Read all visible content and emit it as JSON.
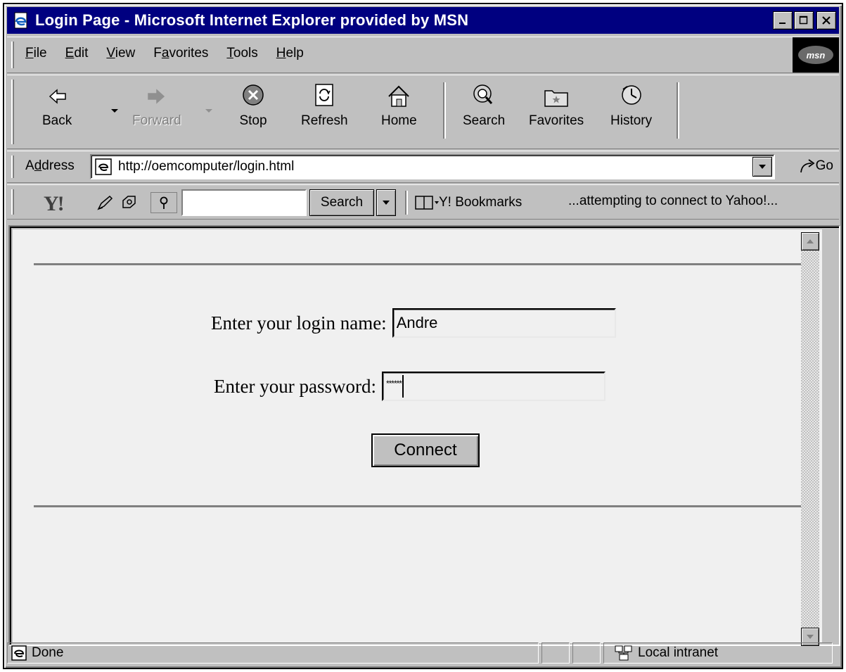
{
  "window": {
    "title": "Login Page - Microsoft Internet Explorer provided by MSN"
  },
  "menu": {
    "items": [
      {
        "label": "File",
        "accel": "F",
        "rest": "ile"
      },
      {
        "label": "Edit",
        "accel": "E",
        "rest": "dit"
      },
      {
        "label": "View",
        "accel": "V",
        "rest": "iew"
      },
      {
        "label": "Favorites",
        "pre": "F",
        "accel": "a",
        "rest": "vorites"
      },
      {
        "label": "Tools",
        "accel": "T",
        "rest": "ools"
      },
      {
        "label": "Help",
        "accel": "H",
        "rest": "elp"
      }
    ],
    "logo_text": "msn"
  },
  "toolbar": {
    "back": "Back",
    "forward": "Forward",
    "stop": "Stop",
    "refresh": "Refresh",
    "home": "Home",
    "search": "Search",
    "favorites": "Favorites",
    "history": "History"
  },
  "address": {
    "label_accel": "d",
    "label_pre": "A",
    "label_rest": "dress",
    "url": "http://oemcomputer/login.html",
    "go_label": "Go"
  },
  "yahoo": {
    "logo": "Y!",
    "search_value": "",
    "search_button": "Search",
    "bookmarks_label": "Y! Bookmarks",
    "status_text": "...attempting to connect to Yahoo!..."
  },
  "form": {
    "login_label": "Enter your login name:",
    "login_value": "Andre",
    "password_label": "Enter your password:",
    "password_value": "******",
    "connect_button": "Connect"
  },
  "status": {
    "text": "Done",
    "zone": "Local intranet"
  },
  "colors": {
    "titlebar": "#000080",
    "chrome": "#c0c0c0",
    "page_bg": "#f0f0f0"
  }
}
